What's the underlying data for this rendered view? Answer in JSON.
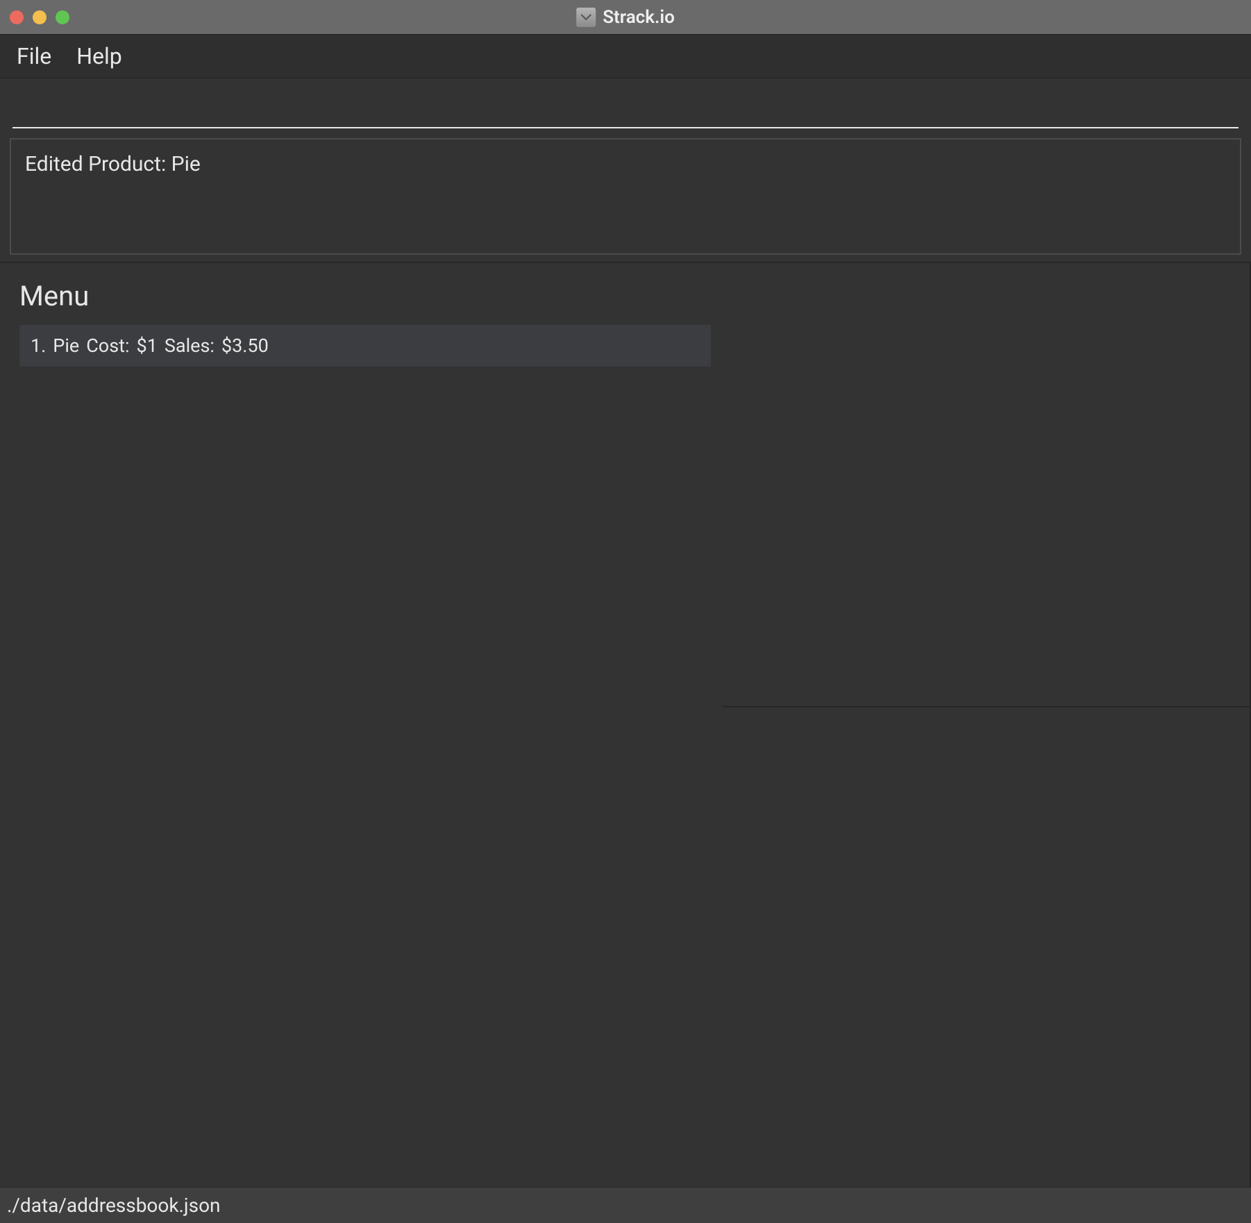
{
  "window": {
    "title": "Strack.io"
  },
  "menubar": {
    "file": "File",
    "help": "Help"
  },
  "command": {
    "value": "",
    "placeholder": ""
  },
  "status": {
    "message": "Edited Product: Pie"
  },
  "menu": {
    "title": "Menu",
    "items": [
      {
        "index": "1.",
        "name": "Pie",
        "cost_label": "Cost:",
        "cost_value": "$1",
        "sales_label": "Sales:",
        "sales_value": "$3.50"
      }
    ]
  },
  "footer": {
    "path": "./data/addressbook.json"
  }
}
